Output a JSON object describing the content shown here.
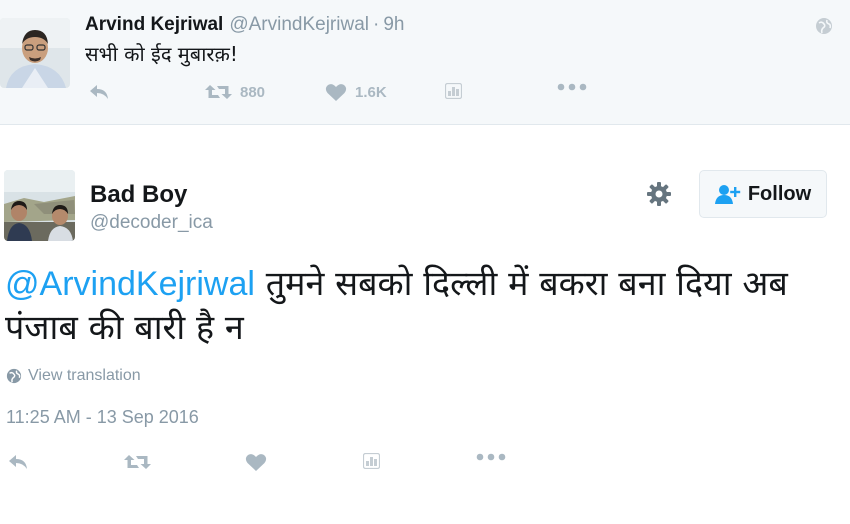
{
  "parent_tweet": {
    "name": "Arvind Kejriwal",
    "handle": "@ArvindKejriwal",
    "separator": "·",
    "time": "9h",
    "text": "सभी को ईद मुबारक़!",
    "retweets": "880",
    "likes": "1.6K"
  },
  "main_tweet": {
    "name": "Bad Boy",
    "handle": "@decoder_ica",
    "follow_label": "Follow",
    "mention": "@ArvindKejriwal",
    "text": " तुमने सबको दिल्ली में बकरा बना दिया अब पंजाब की बारी है न",
    "view_translation": "View translation",
    "timestamp": "11:25 AM - 13 Sep 2016"
  },
  "icons": {
    "reply": "reply-icon",
    "retweet": "retweet-icon",
    "like": "heart-icon",
    "analytics": "analytics-icon",
    "more": "more-icon",
    "globe": "globe-icon",
    "gear": "gear-icon",
    "follow": "add-user-icon"
  },
  "colors": {
    "link": "#1da1f2",
    "muted": "#8899a6",
    "icon": "#aab8c2",
    "parent_bg": "#f5f8fa"
  }
}
